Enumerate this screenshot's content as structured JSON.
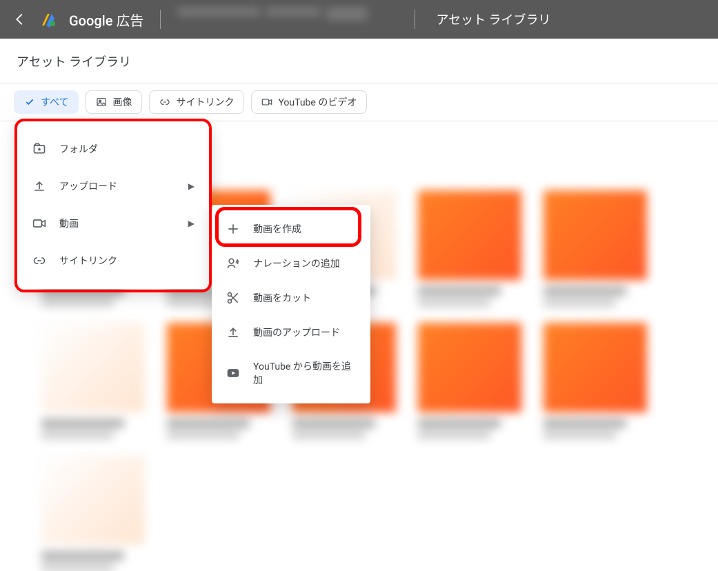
{
  "header": {
    "brand": "Google 広告",
    "section": "アセット ライブラリ"
  },
  "page": {
    "title": "アセット ライブラリ"
  },
  "chips": {
    "all": "すべて",
    "images": "画像",
    "sitelinks": "サイトリンク",
    "youtube": "YouTube のビデオ"
  },
  "menu1": {
    "folder": "フォルダ",
    "upload": "アップロード",
    "video": "動画",
    "sitelink": "サイトリンク"
  },
  "menu2": {
    "create_video": "動画を作成",
    "add_narration": "ナレーションの追加",
    "cut_video": "動画をカット",
    "upload_video": "動画のアップロード",
    "add_from_youtube": "YouTube から動画を追加"
  }
}
